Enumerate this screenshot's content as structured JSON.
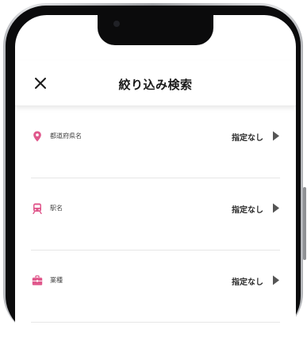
{
  "header": {
    "title": "絞り込み検索",
    "close_icon": "close-icon"
  },
  "filters": [
    {
      "label": "都道府県名",
      "value": "指定なし",
      "icon": "location-pin-icon"
    },
    {
      "label": "駅名",
      "value": "指定なし",
      "icon": "train-icon"
    },
    {
      "label": "業種",
      "value": "指定なし",
      "icon": "briefcase-icon"
    }
  ],
  "colors": {
    "accent": "#e0588c",
    "arrow": "#555555"
  }
}
